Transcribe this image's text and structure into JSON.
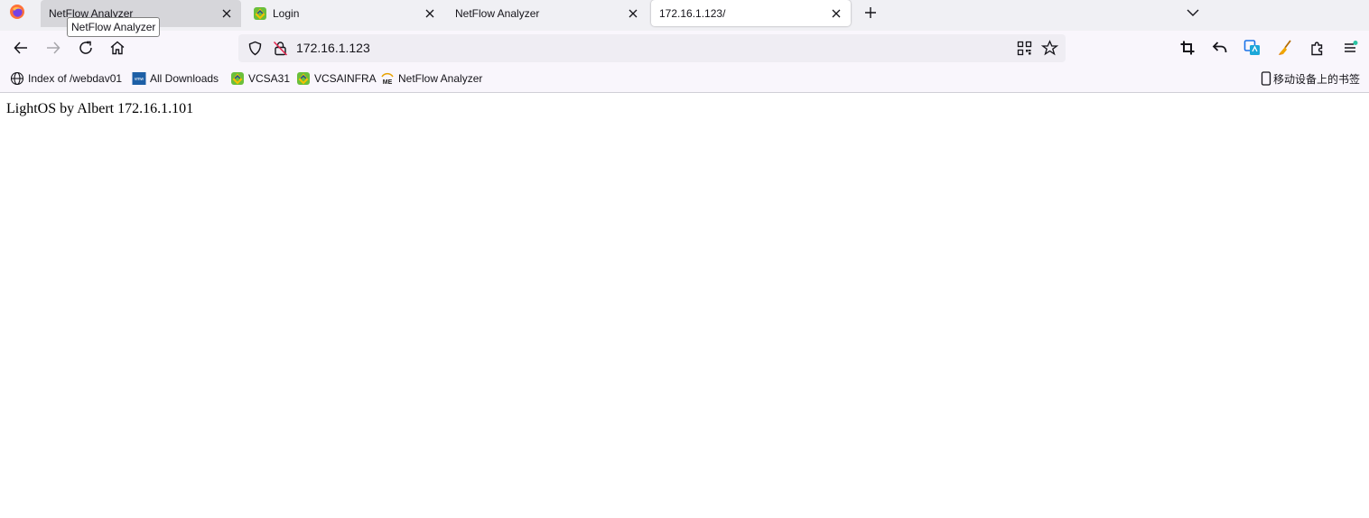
{
  "tabs": [
    {
      "label": "NetFlow Analyzer",
      "state": "hover"
    },
    {
      "label": "Login",
      "state": "normal"
    },
    {
      "label": "NetFlow Analyzer",
      "state": "normal"
    },
    {
      "label": "172.16.1.123/",
      "state": "selected"
    }
  ],
  "tooltip": "NetFlow Analyzer",
  "urlbar": {
    "url": "172.16.1.123"
  },
  "bookmarks": [
    {
      "label": "Index of /webdav01",
      "icon": "globe-icon"
    },
    {
      "label": "All Downloads",
      "icon": "vmware-icon"
    },
    {
      "label": "VCSA31",
      "icon": "vsphere-icon"
    },
    {
      "label": "VCSAINFRA",
      "icon": "vsphere-icon"
    },
    {
      "label": "NetFlow Analyzer",
      "icon": "manageengine-icon"
    }
  ],
  "mobile_bookmarks": "移动设备上的书签",
  "page": {
    "text": "LightOS by Albert 172.16.1.101"
  },
  "colors": {
    "tabbar_bg": "#f0f0f4",
    "toolbar_bg": "#f9f6fc",
    "urlbar_bg": "#efedf3"
  }
}
